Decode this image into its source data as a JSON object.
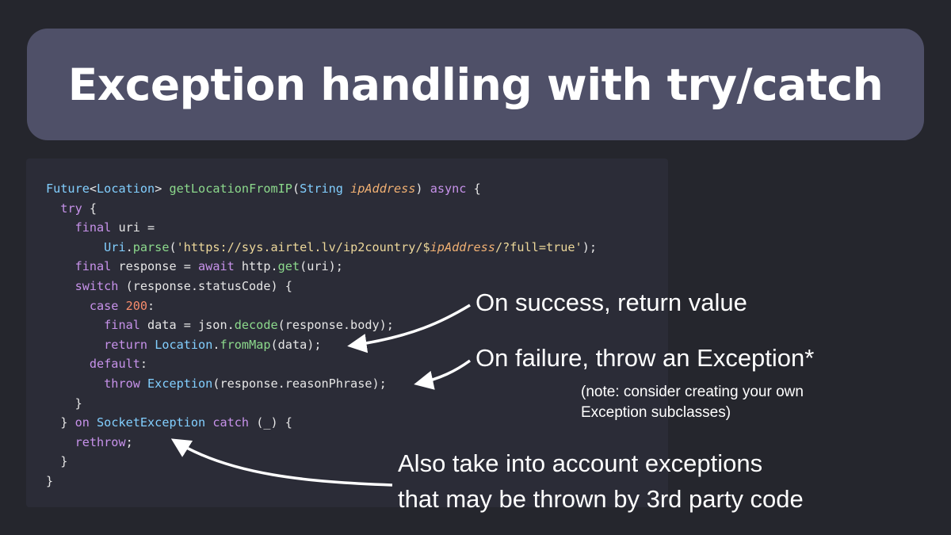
{
  "slide": {
    "title": "Exception handling with try/catch"
  },
  "code": {
    "lines": [
      [
        [
          "ty",
          "Future"
        ],
        [
          "pl",
          "<"
        ],
        [
          "ty",
          "Location"
        ],
        [
          "pl",
          "> "
        ],
        [
          "fn",
          "getLocationFromIP"
        ],
        [
          "pl",
          "("
        ],
        [
          "ty",
          "String"
        ],
        [
          "pl",
          " "
        ],
        [
          "it",
          "ipAddress"
        ],
        [
          "pl",
          ") "
        ],
        [
          "kw",
          "async"
        ],
        [
          "pl",
          " {"
        ]
      ],
      [
        [
          "pl",
          "  "
        ],
        [
          "kw",
          "try"
        ],
        [
          "pl",
          " {"
        ]
      ],
      [
        [
          "pl",
          "    "
        ],
        [
          "kw",
          "final"
        ],
        [
          "pl",
          " uri ="
        ]
      ],
      [
        [
          "pl",
          "        "
        ],
        [
          "ty",
          "Uri"
        ],
        [
          "pl",
          "."
        ],
        [
          "fn",
          "parse"
        ],
        [
          "pl",
          "("
        ],
        [
          "st",
          "'https://sys.airtel.lv/ip2country/$"
        ],
        [
          "it",
          "ipAddress"
        ],
        [
          "st",
          "/?full=true'"
        ],
        [
          "pl",
          ");"
        ]
      ],
      [
        [
          "pl",
          "    "
        ],
        [
          "kw",
          "final"
        ],
        [
          "pl",
          " response = "
        ],
        [
          "kw",
          "await"
        ],
        [
          "pl",
          " http."
        ],
        [
          "fn",
          "get"
        ],
        [
          "pl",
          "(uri);"
        ]
      ],
      [
        [
          "pl",
          "    "
        ],
        [
          "kw",
          "switch"
        ],
        [
          "pl",
          " (response.statusCode) {"
        ]
      ],
      [
        [
          "pl",
          "      "
        ],
        [
          "kw",
          "case"
        ],
        [
          "pl",
          " "
        ],
        [
          "nm",
          "200"
        ],
        [
          "pl",
          ":"
        ]
      ],
      [
        [
          "pl",
          "        "
        ],
        [
          "kw",
          "final"
        ],
        [
          "pl",
          " data = json."
        ],
        [
          "fn",
          "decode"
        ],
        [
          "pl",
          "(response.body);"
        ]
      ],
      [
        [
          "pl",
          "        "
        ],
        [
          "kw",
          "return"
        ],
        [
          "pl",
          " "
        ],
        [
          "ty",
          "Location"
        ],
        [
          "pl",
          "."
        ],
        [
          "fn",
          "fromMap"
        ],
        [
          "pl",
          "(data);"
        ]
      ],
      [
        [
          "pl",
          "      "
        ],
        [
          "kw",
          "default"
        ],
        [
          "pl",
          ":"
        ]
      ],
      [
        [
          "pl",
          "        "
        ],
        [
          "kw",
          "throw"
        ],
        [
          "pl",
          " "
        ],
        [
          "ty",
          "Exception"
        ],
        [
          "pl",
          "(response.reasonPhrase);"
        ]
      ],
      [
        [
          "pl",
          "    }"
        ]
      ],
      [
        [
          "pl",
          "  } "
        ],
        [
          "kw",
          "on"
        ],
        [
          "pl",
          " "
        ],
        [
          "ty",
          "SocketException"
        ],
        [
          "pl",
          " "
        ],
        [
          "kw",
          "catch"
        ],
        [
          "pl",
          " (_) {"
        ]
      ],
      [
        [
          "pl",
          "    "
        ],
        [
          "kw",
          "rethrow"
        ],
        [
          "pl",
          ";"
        ]
      ],
      [
        [
          "pl",
          "  }"
        ]
      ],
      [
        [
          "pl",
          "}"
        ]
      ]
    ]
  },
  "annotations": {
    "success": "On success, return value",
    "failure": "On failure, throw an Exception*",
    "note_line1": "(note: consider creating your own",
    "note_line2": "Exception subclasses)",
    "third_party_line1": "Also take into account exceptions",
    "third_party_line2": "that may be thrown by 3rd party code"
  }
}
